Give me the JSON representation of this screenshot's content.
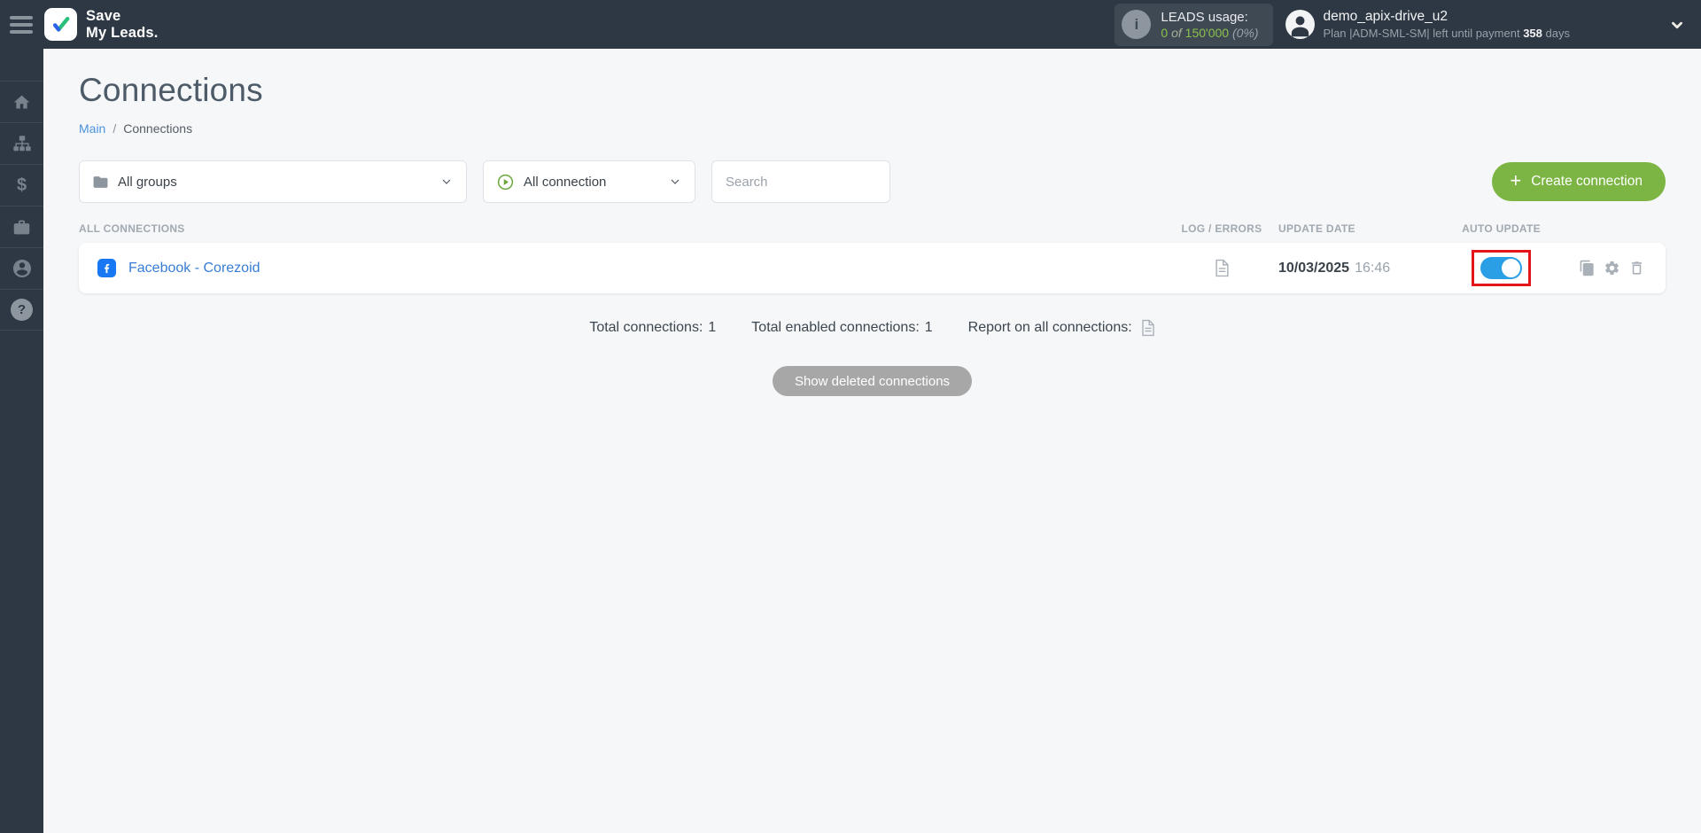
{
  "topbar": {
    "brand_line1": "Save",
    "brand_line2": "My Leads.",
    "leads": {
      "label": "LEADS usage:",
      "used": "0",
      "of_word": "of",
      "total": "150'000",
      "percent": "(0%)"
    },
    "user": {
      "name": "demo_apix-drive_u2",
      "plan_prefix": "Plan |ADM-SML-SM| left until payment",
      "days": "358",
      "days_word": "days"
    }
  },
  "sidebar": {
    "items": [
      "home-icon",
      "connections-icon",
      "payments-icon",
      "services-icon",
      "account-icon",
      "help-icon"
    ],
    "help_glyph": "?"
  },
  "page": {
    "title": "Connections",
    "breadcrumb_main": "Main",
    "breadcrumb_sep": "/",
    "breadcrumb_current": "Connections"
  },
  "filters": {
    "groups_value": "All groups",
    "connection_value": "All connection",
    "search_placeholder": "Search",
    "create_label": "Create connection",
    "create_plus": "+"
  },
  "table": {
    "col_all": "ALL CONNECTIONS",
    "col_log": "LOG / ERRORS",
    "col_update": "UPDATE DATE",
    "col_auto": "AUTO UPDATE",
    "rows": [
      {
        "name": "Facebook - Corezoid",
        "date": "10/03/2025",
        "time": "16:46",
        "auto_update": true
      }
    ]
  },
  "summary": {
    "total_label": "Total connections:",
    "total_value": "1",
    "enabled_label": "Total enabled connections:",
    "enabled_value": "1",
    "report_label": "Report on all connections:"
  },
  "footer": {
    "show_deleted_label": "Show deleted connections"
  },
  "colors": {
    "topbar_bg": "#2e3844",
    "accent_green": "#7cb543",
    "leads_green": "#8bc14a",
    "toggle_blue": "#2b9fe6",
    "highlight_red": "#e3151b",
    "facebook_blue": "#1877f2",
    "link_blue": "#377dd5",
    "content_bg": "#f5f7f9"
  }
}
